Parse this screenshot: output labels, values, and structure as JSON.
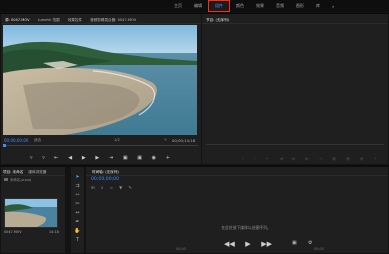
{
  "top_nav": {
    "items": [
      "主页",
      "编辑",
      "组件",
      "颜色",
      "效果",
      "音频",
      "图形",
      "库"
    ],
    "active_index": 2,
    "overflow": "»"
  },
  "source_panel": {
    "tabs": [
      "源: 0047.MOV",
      "Lumetri 范围",
      "效果控件",
      "音频剪辑混合器: 0047.MOV"
    ],
    "timecode_left": "00;00;00;00",
    "fit_label": "适合",
    "quality_label": "1/2",
    "timecode_right": "00;00;14;18"
  },
  "program_panel": {
    "tab": "节目: (无序列)"
  },
  "project_panel": {
    "tabs": [
      "项目: 未命名",
      "媒体浏览器"
    ],
    "project_file": "未命名.prproj",
    "clip_name": "0047.MOV",
    "clip_duration": "14:18"
  },
  "timeline_panel": {
    "tab": "时间轴: (无序列)",
    "timecode": "00;00;00;00",
    "empty_message": "在此处放下媒体以创建序列。",
    "ruler_left": "00;00",
    "ruler_right": "00;00"
  },
  "colors": {
    "accent_blue": "#3f8cff",
    "active_border": "#ff2a1a"
  }
}
